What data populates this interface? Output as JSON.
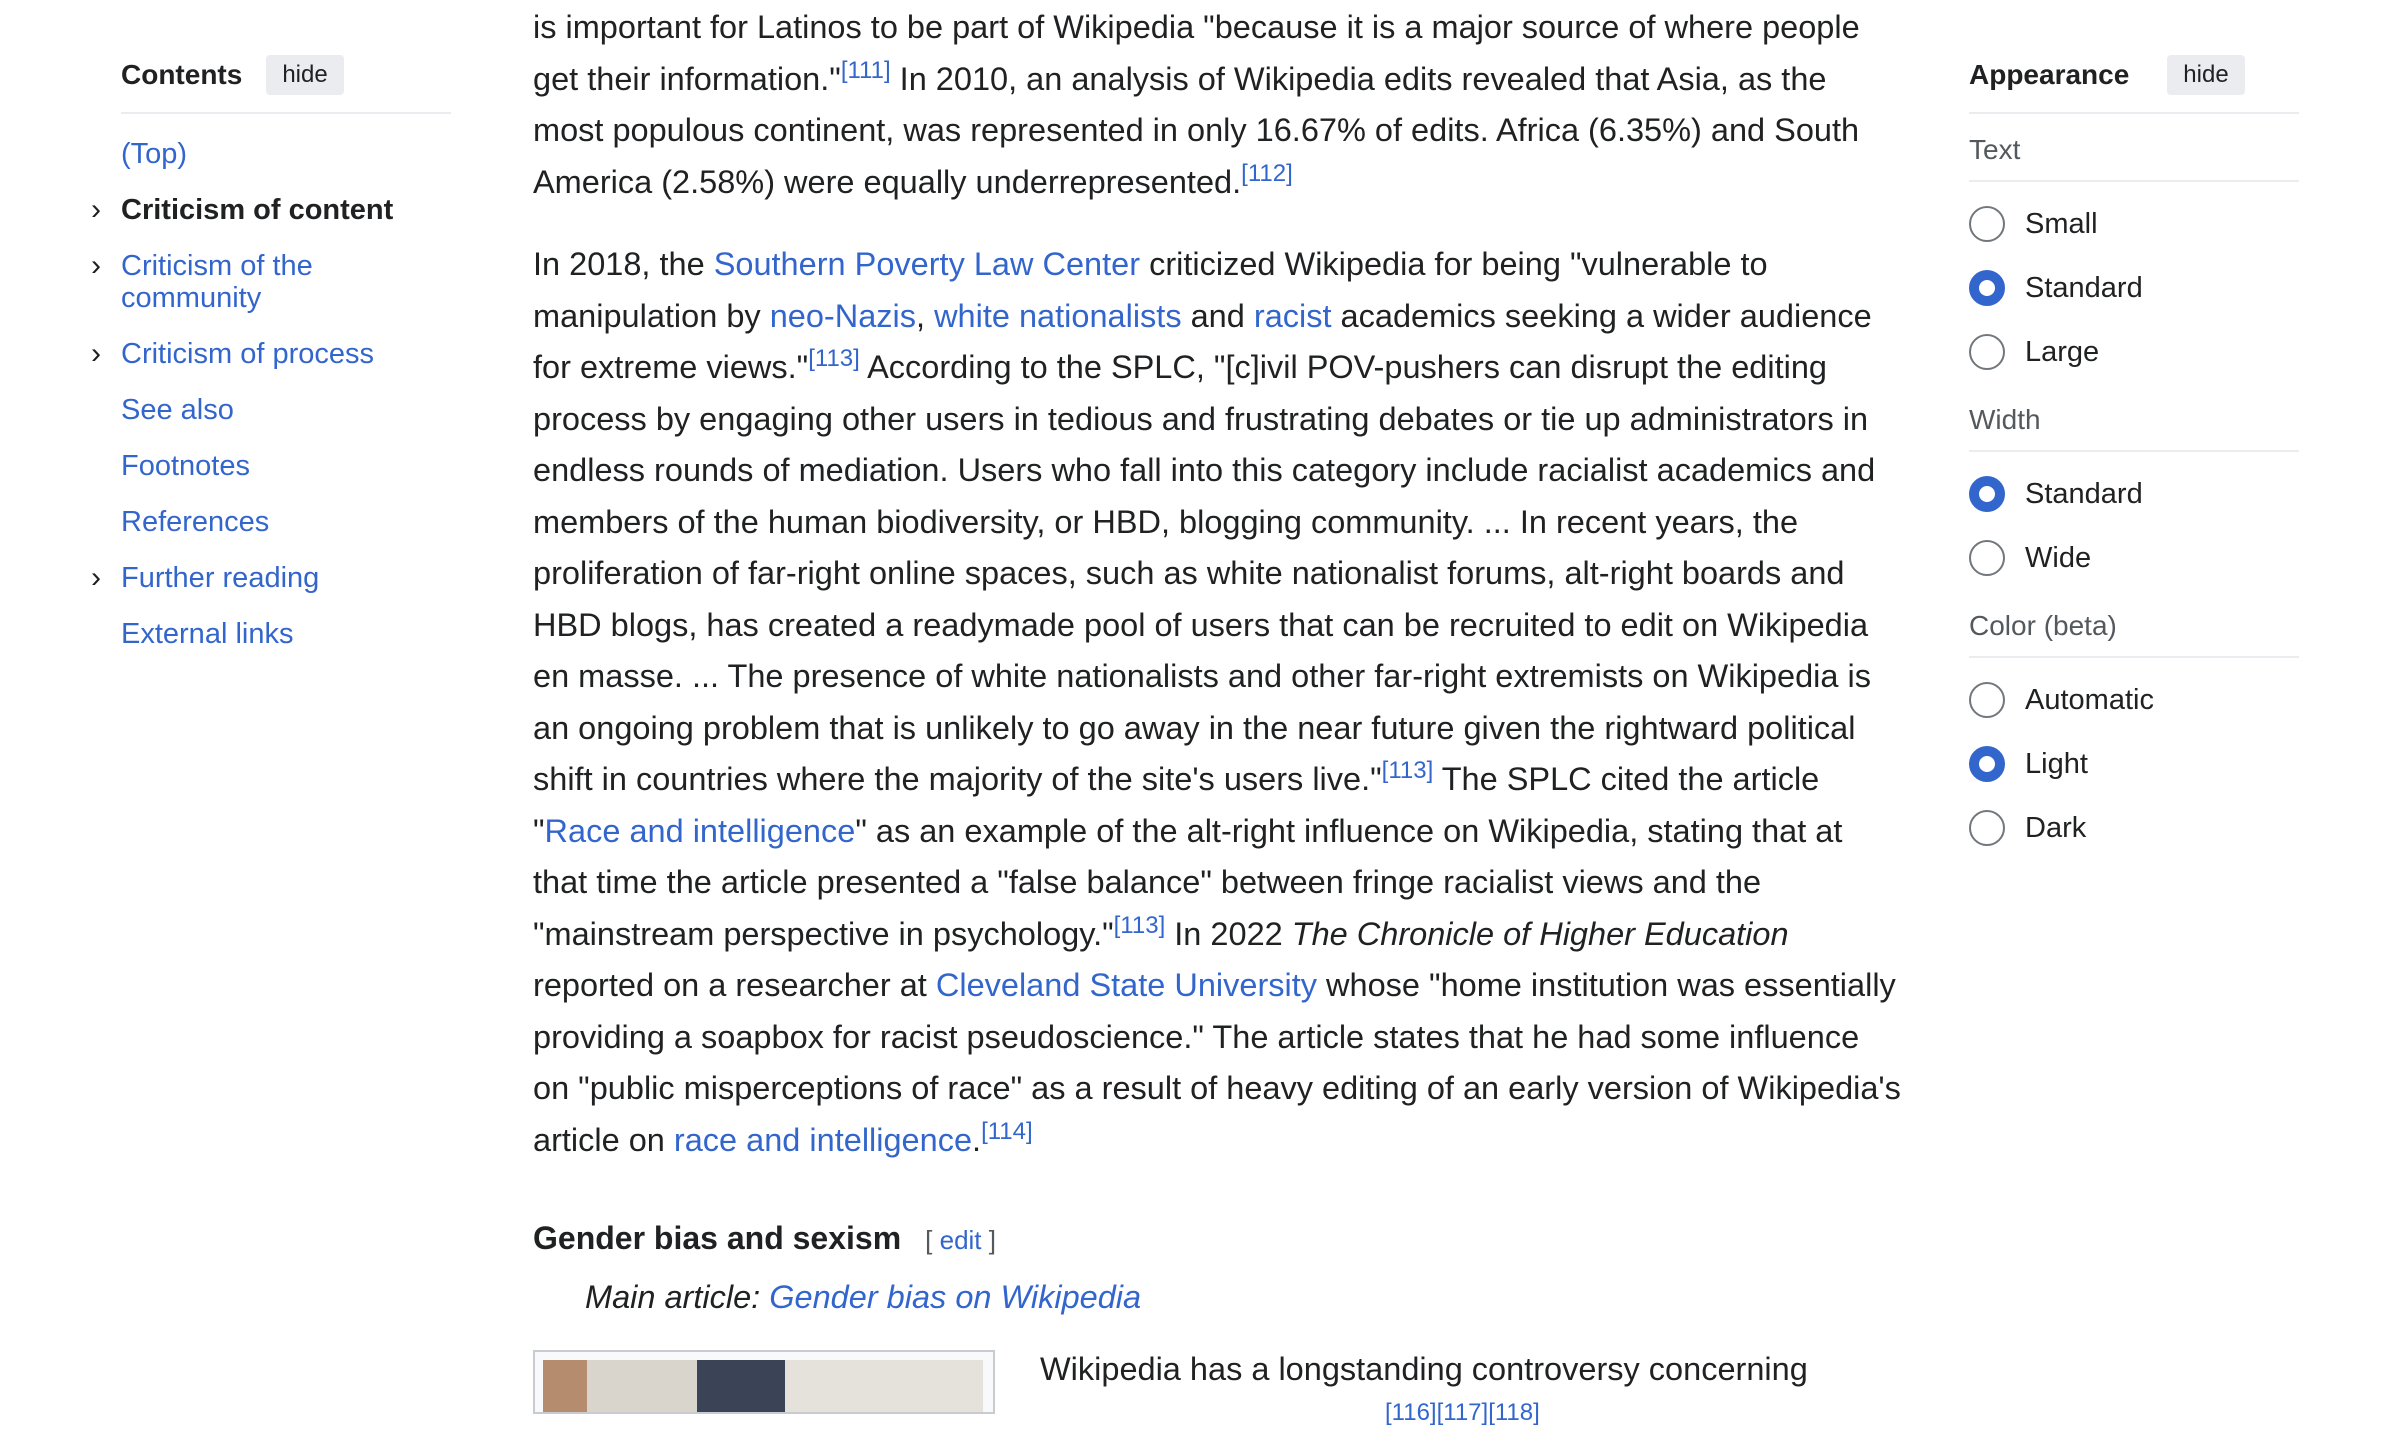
{
  "toc": {
    "title": "Contents",
    "hide_label": "hide",
    "items": [
      {
        "label": "(Top)",
        "expandable": false,
        "active": false
      },
      {
        "label": "Criticism of content",
        "expandable": true,
        "active": true
      },
      {
        "label": "Criticism of the community",
        "expandable": true,
        "active": false
      },
      {
        "label": "Criticism of process",
        "expandable": true,
        "active": false
      },
      {
        "label": "See also",
        "expandable": false,
        "active": false
      },
      {
        "label": "Footnotes",
        "expandable": false,
        "active": false
      },
      {
        "label": "References",
        "expandable": false,
        "active": false
      },
      {
        "label": "Further reading",
        "expandable": true,
        "active": false
      },
      {
        "label": "External links",
        "expandable": false,
        "active": false
      }
    ]
  },
  "article": {
    "p1": {
      "t1": "is important for Latinos to be part of Wikipedia \"because it is a major source of where people get their information.\"",
      "r1": "[111]",
      "t2": " In 2010, an analysis of Wikipedia edits revealed that Asia, as the most populous continent, was represented in only 16.67% of edits. Africa (6.35%) and South America (2.58%) were equally underrepresented.",
      "r2": "[112]"
    },
    "p2": {
      "t1": "In 2018, the ",
      "l_splc": "Southern Poverty Law Center",
      "t2": " criticized Wikipedia for being \"vulnerable to manipulation by ",
      "l_neonazis": "neo-Nazis",
      "t3": ", ",
      "l_whitenat": "white nationalists",
      "t4": " and ",
      "l_racist": "racist",
      "t5": " academics seeking a wider audience for extreme views.\"",
      "r1": "[113]",
      "t6": " According to the SPLC, \"[c]ivil POV-pushers can disrupt the editing process by engaging other users in tedious and frustrating debates or tie up administrators in endless rounds of mediation. Users who fall into this category include racialist academics and members of the human biodiversity, or HBD, blogging community. ... In recent years, the proliferation of far-right online spaces, such as white nationalist forums, alt-right boards and HBD blogs, has created a readymade pool of users that can be recruited to edit on Wikipedia en masse. ... The presence of white nationalists and other far-right extremists on Wikipedia is an ongoing problem that is unlikely to go away in the near future given the rightward political shift in countries where the majority of the site's users live.\"",
      "r2": "[113]",
      "t7": " The SPLC cited the article \"",
      "l_race1": "Race and intelligence",
      "t8": "\" as an example of the alt-right influence on Wikipedia, stating that at that time the article presented a \"false balance\" between fringe racialist views and the \"mainstream perspective in psychology.\"",
      "r3": "[113]",
      "t9": " In 2022 ",
      "i_chronicle": "The Chronicle of Higher Education",
      "t10": " reported on a researcher at ",
      "l_csu": "Cleveland State University",
      "t11": " whose \"home institution was essentially providing a soapbox for racist pseudoscience.\" The article states that he had some influence on \"public misperceptions of race\" as a result of heavy editing of an early version of Wikipedia's article on ",
      "l_race2": "race and intelligence",
      "t12": ".",
      "r4": "[114]"
    },
    "section_heading": "Gender bias and sexism",
    "edit_open": "[ ",
    "edit_label": "edit",
    "edit_close": " ]",
    "hatnote_prefix": "Main article: ",
    "hatnote_link": "Gender bias on Wikipedia",
    "p3": {
      "t1": "Wikipedia has a longstanding controversy concerning",
      "r1": "[116][117][118]"
    }
  },
  "appearance": {
    "title": "Appearance",
    "hide_label": "hide",
    "groups": [
      {
        "label": "Text",
        "options": [
          {
            "label": "Small",
            "selected": false
          },
          {
            "label": "Standard",
            "selected": true
          },
          {
            "label": "Large",
            "selected": false
          }
        ]
      },
      {
        "label": "Width",
        "options": [
          {
            "label": "Standard",
            "selected": true
          },
          {
            "label": "Wide",
            "selected": false
          }
        ]
      },
      {
        "label": "Color (beta)",
        "options": [
          {
            "label": "Automatic",
            "selected": false
          },
          {
            "label": "Light",
            "selected": true
          },
          {
            "label": "Dark",
            "selected": false
          }
        ]
      }
    ]
  },
  "colors": {
    "link": "#3366cc",
    "text": "#202122",
    "radio_selected": "#3366cc"
  }
}
